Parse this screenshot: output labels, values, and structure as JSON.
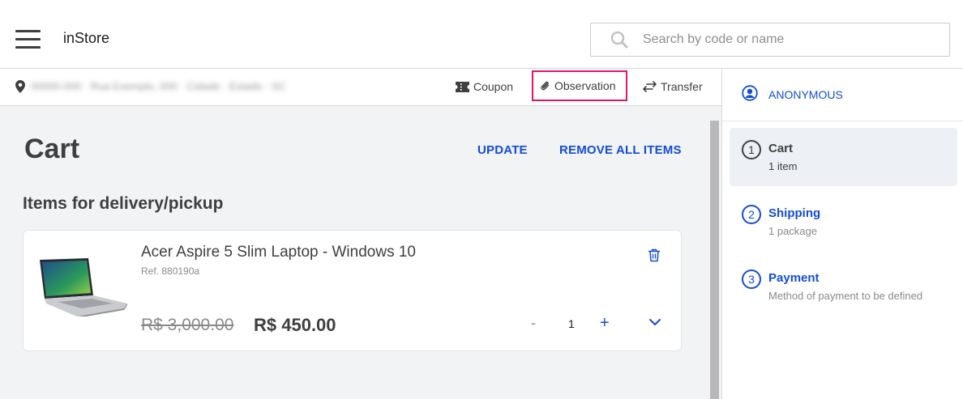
{
  "header": {
    "app_title": "inStore",
    "search_placeholder": "Search by code or name"
  },
  "toolbar": {
    "address": "00000-000 · Rua Exemplo, 000 · Cidade · Estado · SC",
    "coupon_label": "Coupon",
    "observation_label": "Observation",
    "transfer_label": "Transfer"
  },
  "cart": {
    "title": "Cart",
    "update_label": "UPDATE",
    "remove_all_label": "REMOVE ALL ITEMS",
    "section_title": "Items for delivery/pickup",
    "items": [
      {
        "name": "Acer Aspire 5 Slim Laptop - Windows 10",
        "ref": "Ref. 880190a",
        "list_price": "R$ 3,000.00",
        "price": "R$ 450.00",
        "quantity_minus": "-",
        "quantity": "1",
        "quantity_plus": "+"
      }
    ]
  },
  "sidebar": {
    "customer": "ANONYMOUS",
    "steps": [
      {
        "number": "1",
        "label": "Cart",
        "sub": "1 item",
        "active": true
      },
      {
        "number": "2",
        "label": "Shipping",
        "sub": "1 package",
        "active": false
      },
      {
        "number": "3",
        "label": "Payment",
        "sub": "Method of payment to be defined",
        "active": false
      }
    ]
  },
  "colors": {
    "accent": "#134cd8",
    "highlight_border": "#e0166b",
    "background": "#f2f3f5",
    "text": "#3f3f40"
  }
}
